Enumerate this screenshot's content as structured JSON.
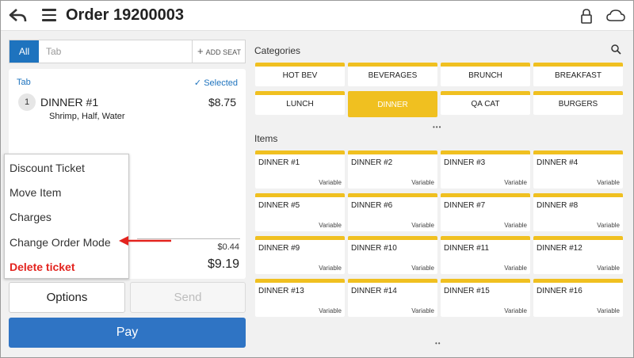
{
  "header": {
    "title": "Order 19200003"
  },
  "tabbar": {
    "all_label": "All",
    "tab_placeholder": "Tab",
    "add_seat_label": "ADD SEAT"
  },
  "ticket": {
    "tab_label": "Tab",
    "selected_label": "Selected",
    "seat_number": "1",
    "item_name": "DINNER #1",
    "item_price": "$8.75",
    "item_modifiers": "Shrimp, Half, Water",
    "tax_value": "$0.44",
    "total_value": "$9.19"
  },
  "popup_menu": {
    "items": [
      "Discount Ticket",
      "Move Item",
      "Charges",
      "Change Order Mode",
      "Delete ticket"
    ]
  },
  "actions": {
    "options_label": "Options",
    "send_label": "Send",
    "pay_label": "Pay"
  },
  "categories": {
    "title": "Categories",
    "items": [
      "HOT BEV",
      "BEVERAGES",
      "BRUNCH",
      "BREAKFAST",
      "LUNCH",
      "DINNER",
      "QA CAT",
      "BURGERS"
    ],
    "active": "DINNER",
    "pager_dots": "•••"
  },
  "items_section": {
    "title": "Items",
    "cards": [
      {
        "name": "DINNER #1",
        "tag": "Variable"
      },
      {
        "name": "DINNER #2",
        "tag": "Variable"
      },
      {
        "name": "DINNER #3",
        "tag": "Variable"
      },
      {
        "name": "DINNER #4",
        "tag": "Variable"
      },
      {
        "name": "DINNER #5",
        "tag": "Variable"
      },
      {
        "name": "DINNER #6",
        "tag": "Variable"
      },
      {
        "name": "DINNER #7",
        "tag": "Variable"
      },
      {
        "name": "DINNER #8",
        "tag": "Variable"
      },
      {
        "name": "DINNER #9",
        "tag": "Variable"
      },
      {
        "name": "DINNER #10",
        "tag": "Variable"
      },
      {
        "name": "DINNER #11",
        "tag": "Variable"
      },
      {
        "name": "DINNER #12",
        "tag": "Variable"
      },
      {
        "name": "DINNER #13",
        "tag": "Variable"
      },
      {
        "name": "DINNER #14",
        "tag": "Variable"
      },
      {
        "name": "DINNER #15",
        "tag": "Variable"
      },
      {
        "name": "DINNER #16",
        "tag": "Variable"
      }
    ],
    "pager_dots": "••"
  },
  "colors": {
    "accent_blue": "#1e73be",
    "category_yellow": "#f0c020",
    "delete_red": "#e3231e",
    "annotation_arrow": "#e3231e"
  },
  "icons": [
    "back-arrow-icon",
    "hamburger-menu-icon",
    "lock-icon",
    "cloud-icon",
    "plus-icon",
    "checkmark-icon",
    "search-icon"
  ]
}
